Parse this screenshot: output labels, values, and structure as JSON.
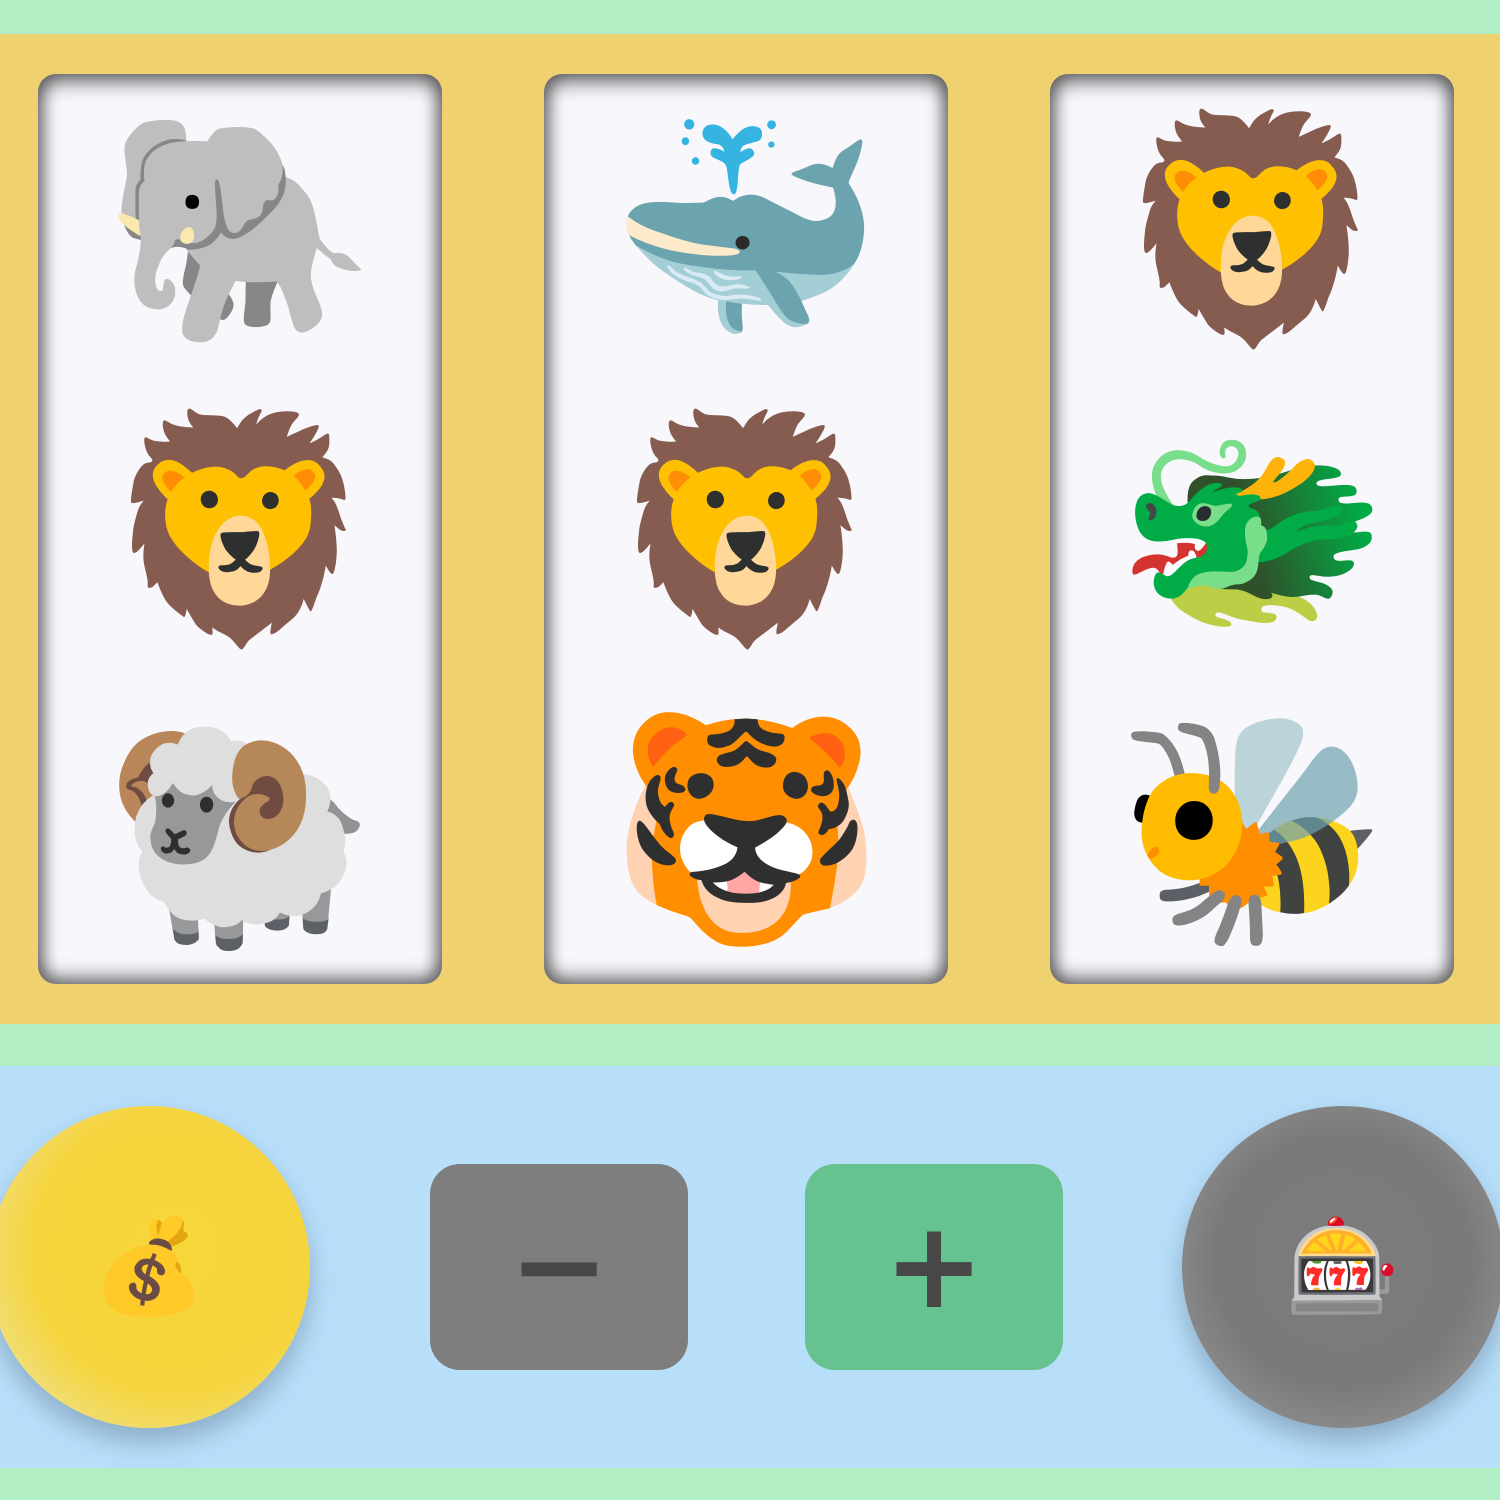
{
  "reels": [
    {
      "symbols": [
        "🐘",
        "🦁",
        "🐏"
      ],
      "icons": [
        "elephant-icon",
        "lion-icon",
        "ram-icon"
      ]
    },
    {
      "symbols": [
        "🐳",
        "🦁",
        "🐯"
      ],
      "icons": [
        "whale-icon",
        "lion-icon",
        "tiger-icon"
      ]
    },
    {
      "symbols": [
        "🦁",
        "🐲",
        "🐝"
      ],
      "icons": [
        "lion-icon",
        "dragon-icon",
        "bee-icon"
      ]
    }
  ],
  "controls": {
    "coin_icon": "💰",
    "minus_label": "−",
    "plus_label": "+",
    "spin_icon": "🎰"
  },
  "colors": {
    "background": "#b2eec3",
    "board": "#efd26f",
    "reel": "#f8f7fb",
    "control_bar": "#b8dffa",
    "coin_button": "#f5d43d",
    "minus_button": "#7e7e7e",
    "plus_button": "#66c28e",
    "spin_button": "#7a7a7a"
  }
}
